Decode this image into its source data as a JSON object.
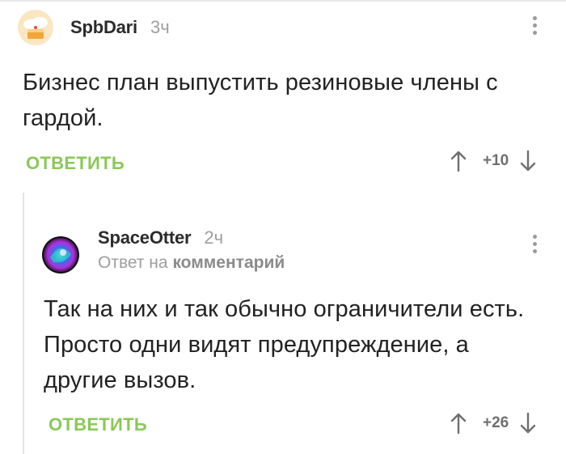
{
  "comments": [
    {
      "username": "SpbDari",
      "time": "3ч",
      "text": "Бизнес план выпустить резиновые члены с гардой.",
      "reply_label": "ОТВЕТИТЬ",
      "rating": "+10"
    },
    {
      "username": "SpaceOtter",
      "time": "2ч",
      "reply_prefix": "Ответ на",
      "reply_target": "комментарий",
      "text": "Так на них и так обычно ограничители есть. Просто одни видят предупреждение, а другие вызов.",
      "reply_label": "ОТВЕТИТЬ",
      "rating": "+26"
    }
  ],
  "colors": {
    "reply_button": "#8ac858",
    "muted_text": "#9e9e9e",
    "thread_line": "#e4e4e4"
  },
  "icons": {
    "avatar_1": "cloud-cake-avatar",
    "avatar_2": "space-otter-avatar",
    "menu": "more-vertical-icon",
    "upvote": "arrow-up-icon",
    "downvote": "arrow-down-icon"
  }
}
